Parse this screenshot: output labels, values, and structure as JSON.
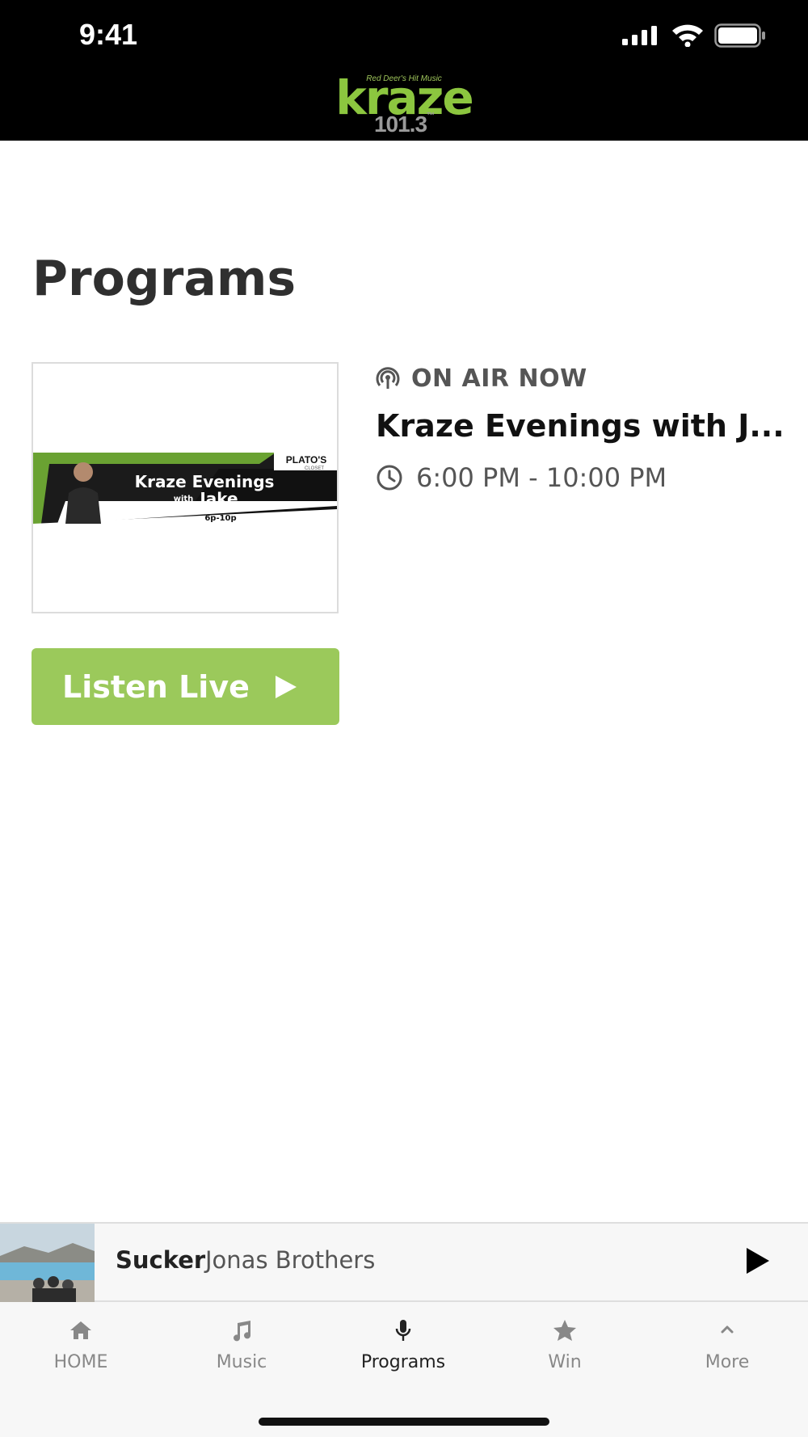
{
  "status_bar": {
    "time": "9:41"
  },
  "header": {
    "logo_tagline": "Red Deer's Hit Music",
    "logo_word": "kraze",
    "logo_frequency": "101.3",
    "logo_trademark": "™"
  },
  "page": {
    "title": "Programs"
  },
  "program": {
    "on_air_label": "ON AIR NOW",
    "name": "Kraze Evenings with J...",
    "time": "6:00 PM - 10:00 PM",
    "banner": {
      "title_line1": "Kraze Evenings",
      "title_with": "with",
      "title_line2": "Jake",
      "hours": "6p-10p",
      "sponsor": "PLATO'S",
      "sponsor_sub": "CLOSET"
    }
  },
  "listen_button": {
    "label": "Listen Live"
  },
  "now_playing": {
    "title": "Sucker",
    "artist": "Jonas Brothers"
  },
  "tabs": [
    {
      "label": "HOME",
      "icon": "home-icon",
      "active": false
    },
    {
      "label": "Music",
      "icon": "music-note-icon",
      "active": false
    },
    {
      "label": "Programs",
      "icon": "microphone-icon",
      "active": true
    },
    {
      "label": "Win",
      "icon": "star-icon",
      "active": false
    },
    {
      "label": "More",
      "icon": "chevron-up-icon",
      "active": false
    }
  ],
  "colors": {
    "brand_green": "#8cc63f",
    "button_green": "#9bc95b",
    "header_bg": "#000000"
  }
}
